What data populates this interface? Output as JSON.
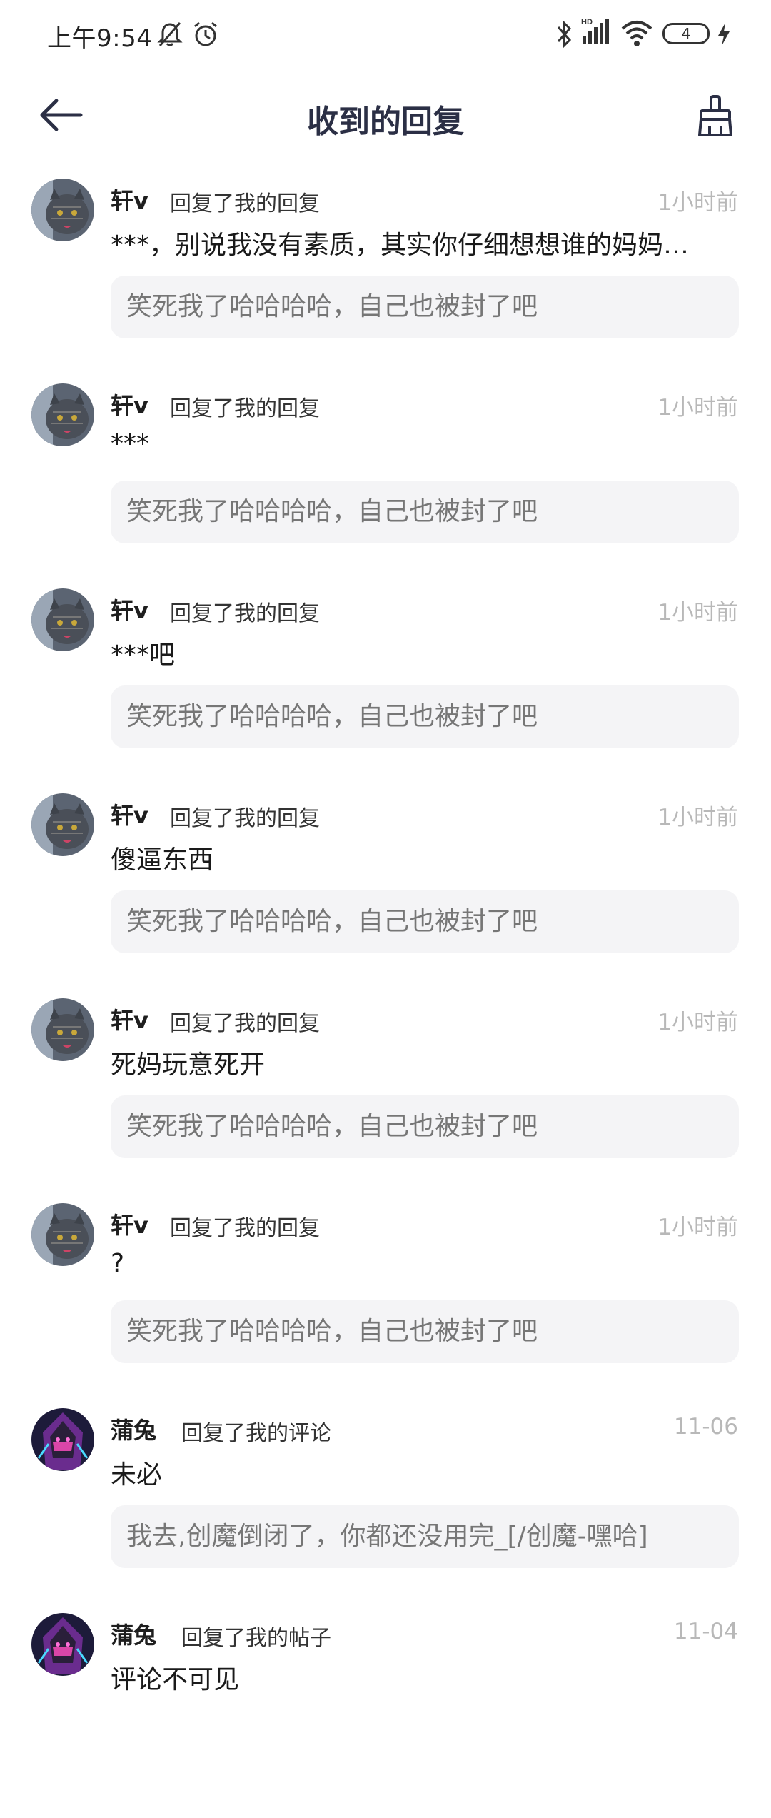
{
  "status_bar": {
    "time": "上午9:54",
    "battery": "4",
    "icons": [
      "bell-off-icon",
      "alarm-icon",
      "bluetooth-icon",
      "signal-hd-icon",
      "wifi-icon",
      "battery-icon",
      "charging-icon"
    ]
  },
  "header": {
    "title": "收到的回复",
    "back_icon": "arrow-left-icon",
    "clear_icon": "broom-icon"
  },
  "items": [
    {
      "name": "轩v",
      "action": "回复了我的回复",
      "time": "1小时前",
      "content": "***，别说我没有素质，其实你仔细想想谁的妈妈…",
      "quote": "笑死我了哈哈哈哈，自己也被封了吧"
    },
    {
      "name": "轩v",
      "action": "回复了我的回复",
      "time": "1小时前",
      "content": "***",
      "quote": "笑死我了哈哈哈哈，自己也被封了吧"
    },
    {
      "name": "轩v",
      "action": "回复了我的回复",
      "time": "1小时前",
      "content": "***吧",
      "quote": "笑死我了哈哈哈哈，自己也被封了吧"
    },
    {
      "name": "轩v",
      "action": "回复了我的回复",
      "time": "1小时前",
      "content": "傻逼东西",
      "quote": "笑死我了哈哈哈哈，自己也被封了吧"
    },
    {
      "name": "轩v",
      "action": "回复了我的回复",
      "time": "1小时前",
      "content": "死妈玩意死开",
      "quote": "笑死我了哈哈哈哈，自己也被封了吧"
    },
    {
      "name": "轩v",
      "action": "回复了我的回复",
      "time": "1小时前",
      "content": "?",
      "quote": "笑死我了哈哈哈哈，自己也被封了吧"
    },
    {
      "name": "蒲兔",
      "action": "回复了我的评论",
      "time": "11-06",
      "content": "未必",
      "quote": "我去,创魔倒闭了，你都还没用完_[/创魔-嘿哈]"
    },
    {
      "name": "蒲兔",
      "action": "回复了我的帖子",
      "time": "11-04",
      "content": "评论不可见",
      "quote": ""
    }
  ],
  "colors": {
    "title": "#2b2f45",
    "time": "#b8b8b8",
    "quote_bg": "#f4f4f6",
    "quote_text": "#767676"
  }
}
